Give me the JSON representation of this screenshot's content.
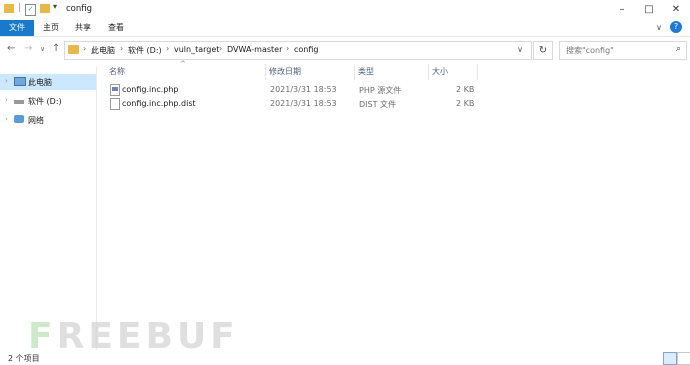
{
  "window": {
    "title": "config",
    "minimize": "–",
    "maximize": "□",
    "close": "✕"
  },
  "ribbon": {
    "file": "文件",
    "home": "主页",
    "share": "共享",
    "view": "查看"
  },
  "nav": {
    "back": "←",
    "forward": "→",
    "recent": "∨",
    "up": "↑",
    "breadcrumbs": [
      "此电脑",
      "软件 (D:)",
      "vuln_target",
      "DVWA-master",
      "config"
    ],
    "separator": "›",
    "refresh": "↻",
    "search_placeholder": "搜索\"config\""
  },
  "sidebar": {
    "items": [
      {
        "label": "此电脑",
        "icon": "computer-icon",
        "selected": true
      },
      {
        "label": "软件 (D:)",
        "icon": "drive-icon",
        "selected": false
      },
      {
        "label": "网络",
        "icon": "network-icon",
        "selected": false
      }
    ]
  },
  "columns": {
    "name": "名称",
    "modified": "修改日期",
    "type": "类型",
    "size": "大小"
  },
  "files": [
    {
      "name": "config.inc.php",
      "modified": "2021/3/31 18:53",
      "type": "PHP 源文件",
      "size": "2 KB",
      "icon": "php-file-icon"
    },
    {
      "name": "config.inc.php.dist",
      "modified": "2021/3/31 18:53",
      "type": "DIST 文件",
      "size": "2 KB",
      "icon": "file-icon"
    }
  ],
  "status": {
    "count": "2 个项目"
  },
  "watermark": {
    "first": "F",
    "rest": "REEBUF"
  }
}
